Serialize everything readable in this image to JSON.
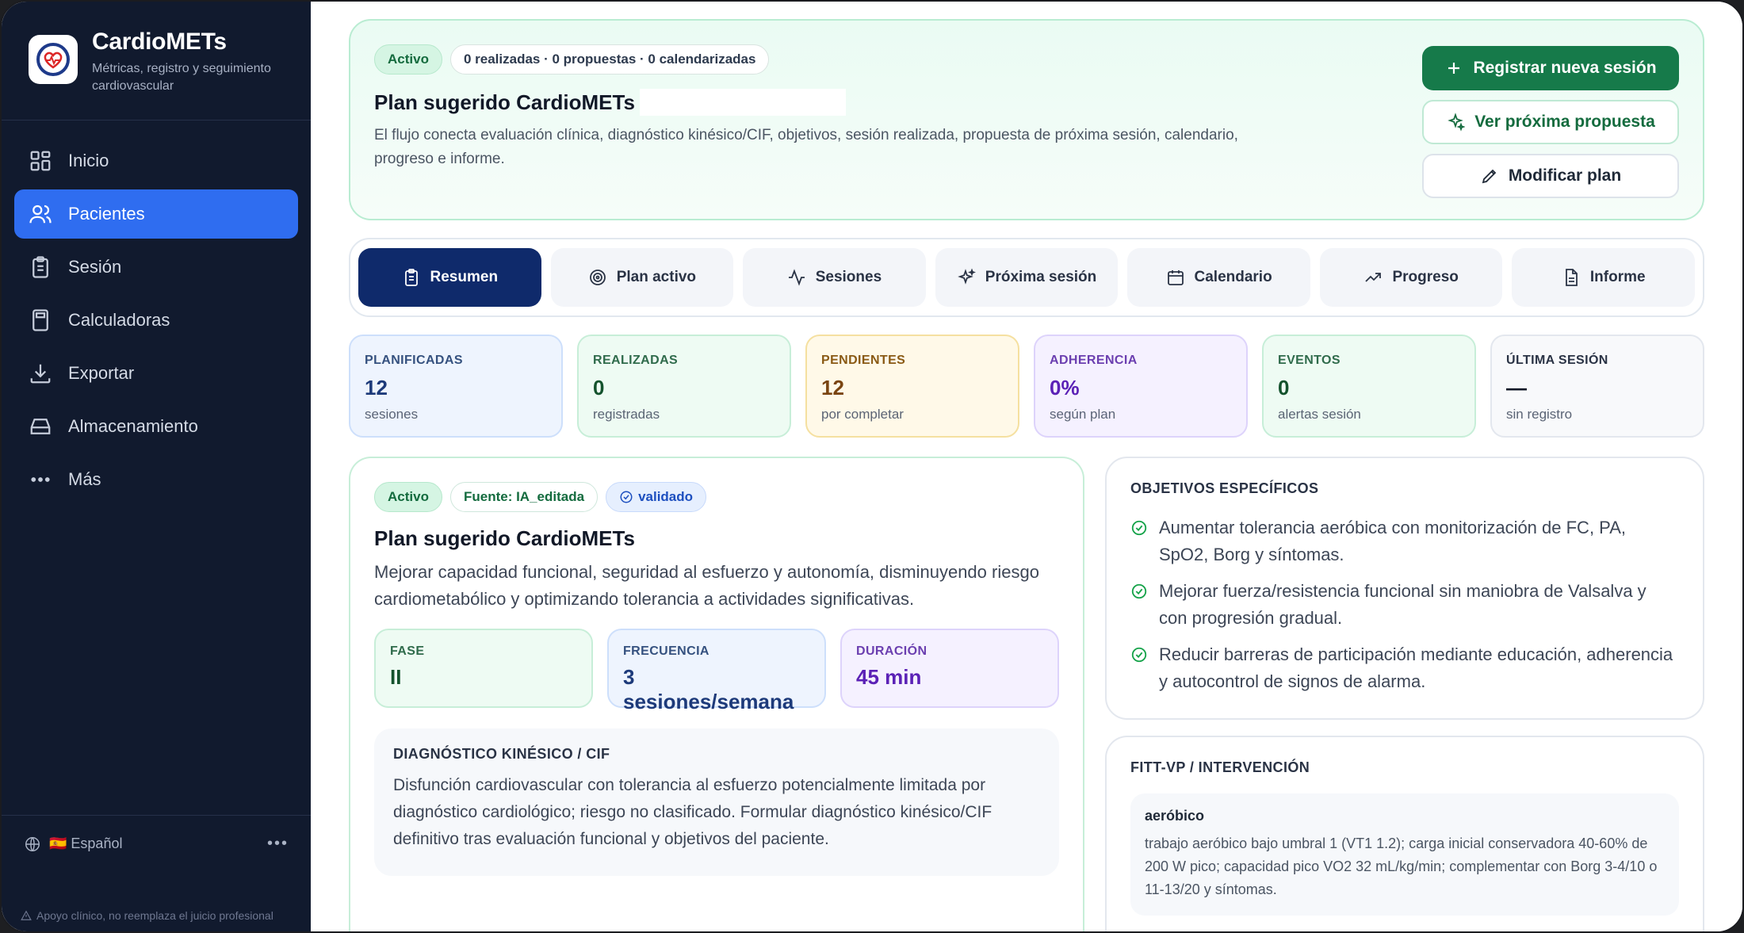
{
  "brand": {
    "name": "CardioMETs",
    "subtitle": "Métricas, registro y seguimiento cardiovascular"
  },
  "sidebar": {
    "items": [
      {
        "label": "Inicio",
        "icon": "grid-icon",
        "active": false
      },
      {
        "label": "Pacientes",
        "icon": "users-icon",
        "active": true
      },
      {
        "label": "Sesión",
        "icon": "clipboard-icon",
        "active": false
      },
      {
        "label": "Calculadoras",
        "icon": "calculator-icon",
        "active": false
      },
      {
        "label": "Exportar",
        "icon": "download-icon",
        "active": false
      },
      {
        "label": "Almacenamiento",
        "icon": "storage-icon",
        "active": false
      },
      {
        "label": "Más",
        "icon": "more-icon",
        "active": false
      }
    ],
    "language": "🇪🇸 Español",
    "disclaimer": "Apoyo clínico, no reemplaza el juicio profesional"
  },
  "hero": {
    "status": "Activo",
    "counts": "0 realizadas · 0 propuestas · 0 calendarizadas",
    "title": "Plan sugerido CardioMETs",
    "description": "El flujo conecta evaluación clínica, diagnóstico kinésico/CIF, objetivos, sesión realizada, propuesta de próxima sesión, calendario, progreso e informe.",
    "actions": {
      "register": "Registrar nueva sesión",
      "next": "Ver próxima propuesta",
      "modify": "Modificar plan"
    }
  },
  "tabs": [
    {
      "label": "Resumen",
      "icon": "clipboard-icon",
      "active": true
    },
    {
      "label": "Plan activo",
      "icon": "target-icon",
      "active": false
    },
    {
      "label": "Sesiones",
      "icon": "activity-icon",
      "active": false
    },
    {
      "label": "Próxima sesión",
      "icon": "sparkles-icon",
      "active": false
    },
    {
      "label": "Calendario",
      "icon": "calendar-icon",
      "active": false
    },
    {
      "label": "Progreso",
      "icon": "trending-up-icon",
      "active": false
    },
    {
      "label": "Informe",
      "icon": "file-icon",
      "active": false
    }
  ],
  "stats": [
    {
      "label": "PLANIFICADAS",
      "value": "12",
      "sub": "sesiones"
    },
    {
      "label": "REALIZADAS",
      "value": "0",
      "sub": "registradas"
    },
    {
      "label": "PENDIENTES",
      "value": "12",
      "sub": "por completar"
    },
    {
      "label": "ADHERENCIA",
      "value": "0%",
      "sub": "según plan"
    },
    {
      "label": "EVENTOS",
      "value": "0",
      "sub": "alertas sesión"
    },
    {
      "label": "ÚLTIMA SESIÓN",
      "value": "—",
      "sub": "sin registro"
    }
  ],
  "plan": {
    "status": "Activo",
    "source": "Fuente: IA_editada",
    "validated": "validado",
    "title": "Plan sugerido CardioMETs",
    "description": "Mejorar capacidad funcional, seguridad al esfuerzo y autonomía, disminuyendo riesgo cardiometabólico y optimizando tolerancia a actividades significativas.",
    "metrics": [
      {
        "label": "FASE",
        "value": "II"
      },
      {
        "label": "FRECUENCIA",
        "value": "3 sesiones/semana"
      },
      {
        "label": "DURACIÓN",
        "value": "45 min"
      }
    ],
    "diagnosis": {
      "label": "DIAGNÓSTICO KINÉSICO / CIF",
      "text": "Disfunción cardiovascular con tolerancia al esfuerzo potencialmente limitada por diagnóstico cardiológico; riesgo no clasificado. Formular diagnóstico kinésico/CIF definitivo tras evaluación funcional y objetivos del paciente."
    }
  },
  "objectives": {
    "label": "OBJETIVOS ESPECÍFICOS",
    "items": [
      "Aumentar tolerancia aeróbica con monitorización de FC, PA, SpO2, Borg y síntomas.",
      "Mejorar fuerza/resistencia funcional sin maniobra de Valsalva y con progresión gradual.",
      "Reducir barreras de participación mediante educación, adherencia y autocontrol de signos de alarma."
    ]
  },
  "fitt": {
    "label": "FITT-VP / INTERVENCIÓN",
    "box_title": "aeróbico",
    "box_text": "trabajo aeróbico bajo umbral 1 (VT1 1.2); carga inicial conservadora 40-60% de 200 W pico; capacidad pico VO2 32 mL/kg/min; complementar con Borg 3-4/10 o 11-13/20 y síntomas."
  }
}
